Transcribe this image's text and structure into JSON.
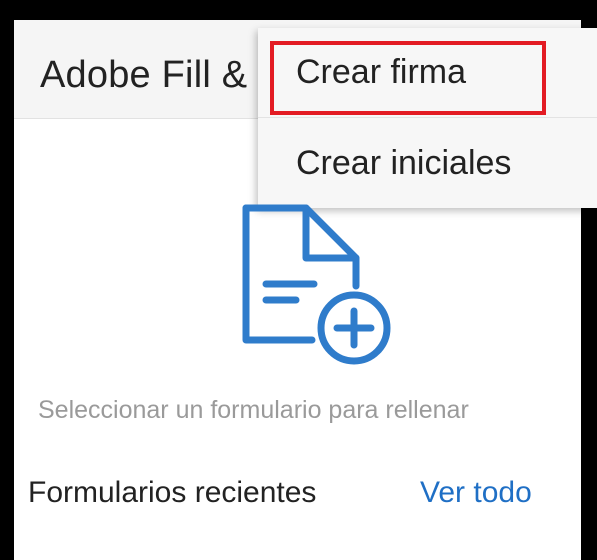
{
  "header": {
    "app_title": "Adobe Fill & Sign"
  },
  "menu": {
    "items": [
      {
        "label": "Crear firma",
        "highlighted": true
      },
      {
        "label": "Crear iniciales"
      }
    ]
  },
  "main": {
    "icon": "document-add-icon",
    "prompt": "Seleccionar un formulario para rellenar",
    "recent_label": "Formularios recientes",
    "view_all_label": "Ver todo"
  },
  "colors": {
    "accent": "#1f6fc5",
    "highlight": "#e31b23",
    "icon": "#2f7ccb"
  }
}
